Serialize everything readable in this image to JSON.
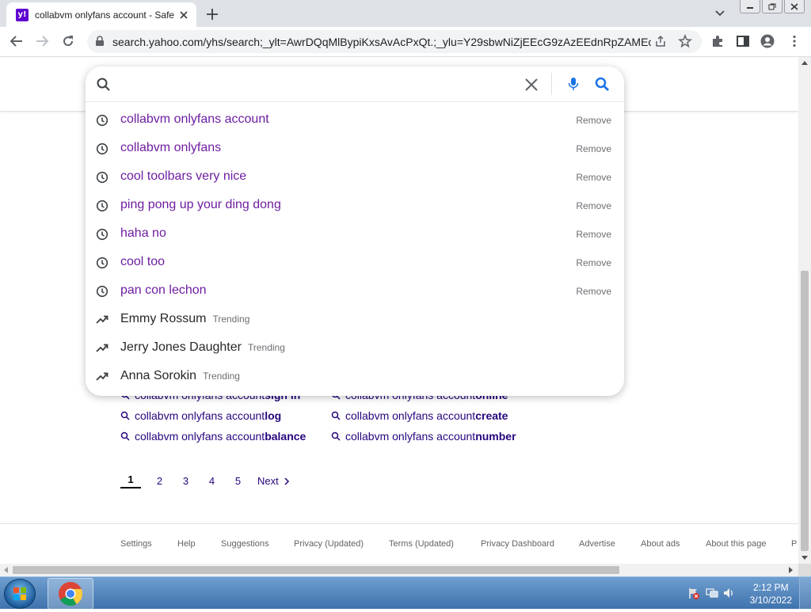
{
  "browser": {
    "tab_title": "collabvm onlyfans account - Safe",
    "url": "search.yahoo.com/yhs/search;_ylt=AwrDQqMlBypiKxsAvAcPxQt.;_ylu=Y29sbwNiZjEEcG9zAzEEdnRpZAMEc2..."
  },
  "search": {
    "query": "",
    "suggestions": [
      {
        "text": "collabvm onlyfans account",
        "type": "history",
        "action": "Remove"
      },
      {
        "text": "collabvm onlyfans",
        "type": "history",
        "action": "Remove"
      },
      {
        "text": "cool toolbars very nice",
        "type": "history",
        "action": "Remove"
      },
      {
        "text": "ping pong up your ding dong",
        "type": "history",
        "action": "Remove"
      },
      {
        "text": "haha no",
        "type": "history",
        "action": "Remove"
      },
      {
        "text": "cool too",
        "type": "history",
        "action": "Remove"
      },
      {
        "text": "pan con lechon",
        "type": "history",
        "action": "Remove"
      },
      {
        "text": "Emmy Rossum",
        "type": "trending",
        "badge": "Trending"
      },
      {
        "text": "Jerry Jones Daughter",
        "type": "trending",
        "badge": "Trending"
      },
      {
        "text": "Anna Sorokin",
        "type": "trending",
        "badge": "Trending"
      }
    ]
  },
  "related": [
    {
      "prefix": "collabvm onlyfans account ",
      "bold": "sign in"
    },
    {
      "prefix": "collabvm onlyfans account ",
      "bold": "online"
    },
    {
      "prefix": "collabvm onlyfans account ",
      "bold": "log"
    },
    {
      "prefix": "collabvm onlyfans account ",
      "bold": "create"
    },
    {
      "prefix": "collabvm onlyfans account ",
      "bold": "balance"
    },
    {
      "prefix": "collabvm onlyfans account ",
      "bold": "number"
    }
  ],
  "pagination": {
    "pages": [
      "1",
      "2",
      "3",
      "4",
      "5"
    ],
    "current": "1",
    "next": "Next"
  },
  "footer": [
    "Settings",
    "Help",
    "Suggestions",
    "Privacy (Updated)",
    "Terms (Updated)",
    "Privacy Dashboard",
    "Advertise",
    "About ads",
    "About this page",
    "P"
  ],
  "taskbar": {
    "time": "2:12 PM",
    "date": "3/10/2022"
  },
  "colors": {
    "history": "#6e1ea0",
    "link": "#26057d",
    "search_blue": "#1a73e8"
  },
  "icons": {
    "history": "clock-icon",
    "trending": "trending-up-icon"
  }
}
